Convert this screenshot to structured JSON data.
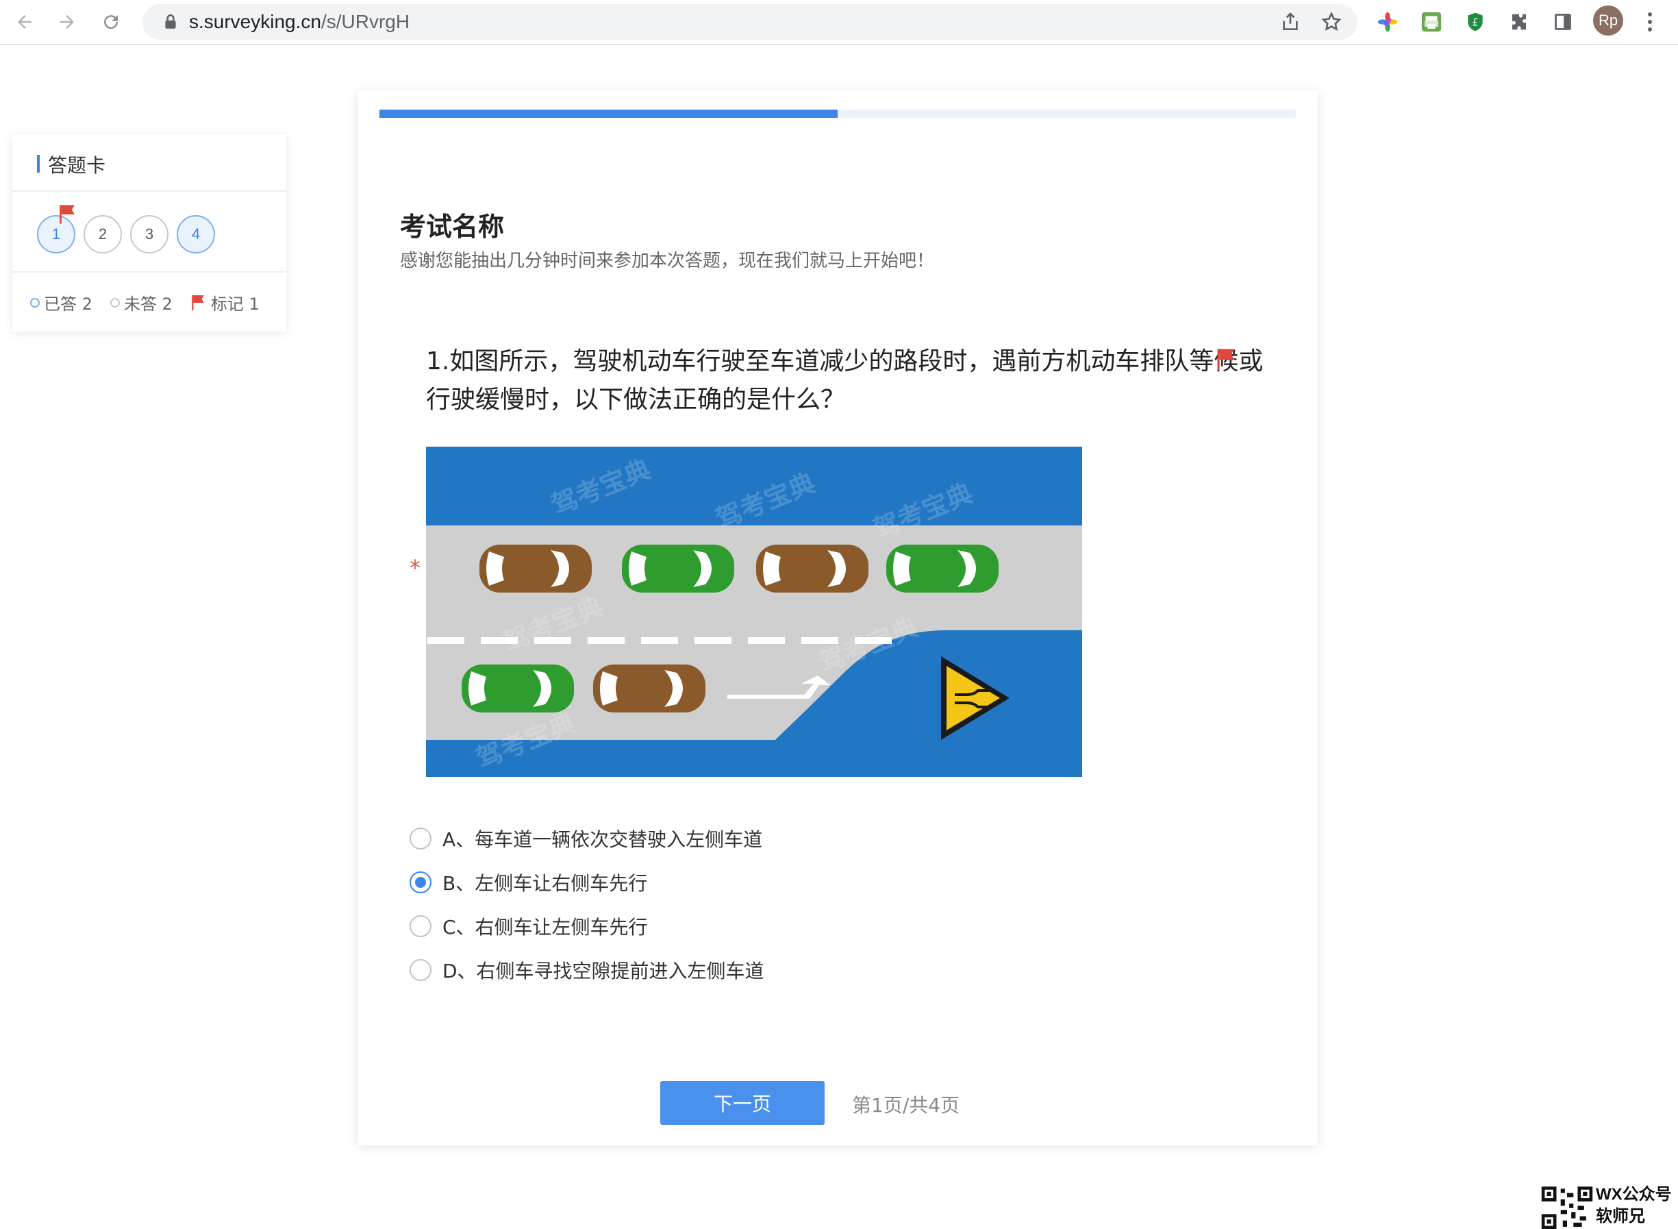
{
  "browser": {
    "url_host": "s.surveyking.cn",
    "url_path": "/s/URvrgH",
    "avatar_initials": "Rp",
    "icons": [
      "back-arrow-icon",
      "forward-arrow-icon",
      "reload-icon",
      "lock-icon",
      "share-icon",
      "star-icon",
      "extension-pinwheel-icon",
      "extension-printer-icon",
      "extension-shield-icon",
      "puzzle-icon",
      "sidepanel-icon",
      "more-vertical-icon"
    ]
  },
  "answer_card": {
    "title": "答题卡",
    "numbers": [
      {
        "label": "1",
        "answered": true,
        "flagged": true
      },
      {
        "label": "2",
        "answered": false,
        "flagged": false
      },
      {
        "label": "3",
        "answered": false,
        "flagged": false
      },
      {
        "label": "4",
        "answered": true,
        "flagged": false
      }
    ],
    "legend": {
      "answered": "已答 2",
      "unanswered": "未答 2",
      "marked": "标记 1"
    }
  },
  "exam": {
    "progress_fraction": 0.5,
    "title": "考试名称",
    "description": "感谢您能抽出几分钟时间来参加本次答题，现在我们就马上开始吧！",
    "question": {
      "text": "1.如图所示，驾驶机动车行驶至车道减少的路段时，遇前方机动车排队等候或行驶缓慢时，以下做法正确的是什么？",
      "required_mark": "*",
      "image_watermark": "驾考宝典",
      "options": [
        {
          "label": "A、每车道一辆依次交替驶入左侧车道",
          "selected": false
        },
        {
          "label": "B、左侧车让右侧车先行",
          "selected": true
        },
        {
          "label": "C、右侧车让左侧车先行",
          "selected": false
        },
        {
          "label": "D、右侧车寻找空隙提前进入左侧车道",
          "selected": false
        }
      ]
    },
    "next_button": "下一页",
    "page_info": "第1页/共4页"
  },
  "watermark": {
    "line1": "WX公众号",
    "line2": "软师兄"
  },
  "colors": {
    "accent": "#3b86e8",
    "required": "#e05c4b",
    "flag": "#e0483e",
    "road_blue": "#2277c4",
    "road_gray": "#cfcfcf",
    "car_brown": "#8b5a2b",
    "car_green": "#2e9c2e",
    "sign_yellow": "#f5c518"
  }
}
